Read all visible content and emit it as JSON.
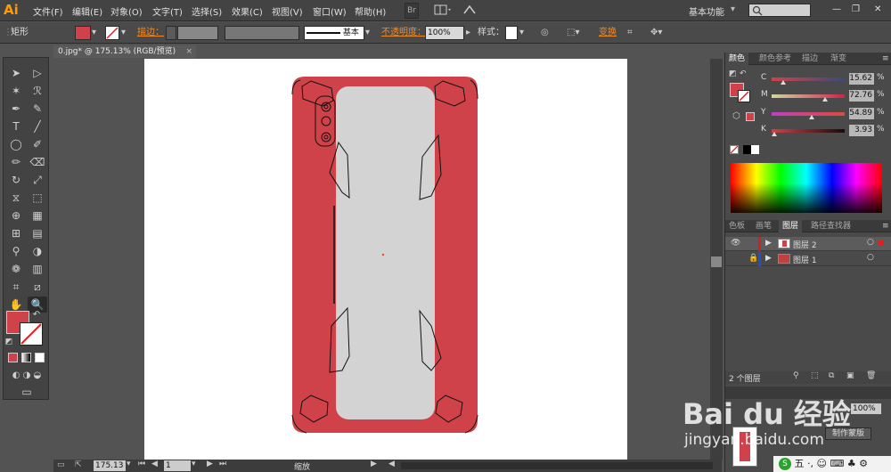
{
  "app": {
    "logo": "Ai"
  },
  "menu": [
    "文件(F)",
    "编辑(E)",
    "对象(O)",
    "文字(T)",
    "选择(S)",
    "效果(C)",
    "视图(V)",
    "窗口(W)",
    "帮助(H)"
  ],
  "menubar_buttons": {
    "br": "Br",
    "workspace": "基本功能"
  },
  "control_bar": {
    "object_type": "矩形",
    "stroke_label": "描边：",
    "stroke_profile": "基本",
    "opacity_label": "不透明度：",
    "opacity_value": "100%",
    "style_label": "样式：",
    "transform_label": "变换",
    "fill_color": "#d0424a"
  },
  "document": {
    "tab_title": "0.jpg* @ 175.13% (RGB/预览)",
    "close": "×"
  },
  "status": {
    "zoom": "175.13",
    "page": "1",
    "tool_name": "缩放"
  },
  "color_panel": {
    "tabs": [
      "颜色",
      "颜色参考",
      "描边",
      "渐变"
    ],
    "channels": [
      {
        "name": "C",
        "value": "15.62",
        "percent": 15.62
      },
      {
        "name": "M",
        "value": "72.76",
        "percent": 72.76
      },
      {
        "name": "Y",
        "value": "54.89",
        "percent": 54.89
      },
      {
        "name": "K",
        "value": "3.93",
        "percent": 3.93
      }
    ],
    "unit": "%"
  },
  "layers_panel": {
    "tabs": [
      "色板",
      "画笔",
      "图层",
      "路径查找器"
    ],
    "layers": [
      {
        "name": "图层 2"
      },
      {
        "name": "图层 1"
      }
    ],
    "count_label": "2 个图层"
  },
  "bottom_panel": {
    "make_mask": "制作蒙版",
    "percent": "100%"
  },
  "watermark": {
    "logo": "Bai du 经验",
    "url": "jingyan.baidu.com"
  },
  "ime": {
    "text": "五 ·, ☺ ⌨ ♣ ⚙"
  },
  "phone": {
    "body_color": "#d0424a",
    "screen_color": "#d3d3d3"
  }
}
